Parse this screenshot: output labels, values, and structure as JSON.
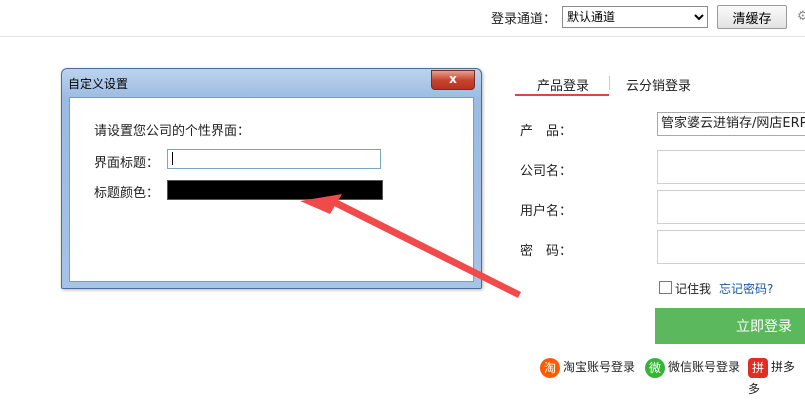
{
  "topbar": {
    "channel_label": "登录通道：",
    "channel_selected": "默认通道",
    "clear_cache": "清缓存"
  },
  "dialog": {
    "title": "自定义设置",
    "close_glyph": "x",
    "prompt": "请设置您公司的个性界面：",
    "title_label": "界面标题：",
    "title_value": "",
    "color_label": "标题颜色：",
    "color_value": "#000000"
  },
  "login": {
    "tabs": [
      {
        "label": "产品登录",
        "active": true
      },
      {
        "label": "云分销登录",
        "active": false
      }
    ],
    "product_label": "产　品：",
    "product_value": "管家婆云进销存/网店ERP",
    "company_label": "公司名：",
    "user_label": "用户名：",
    "password_label": "密　码：",
    "remember_label": "记住我",
    "forgot_label": "忘记密码?",
    "login_button": "立即登录",
    "third_party": [
      {
        "icon": "taobao-icon",
        "glyph": "淘",
        "label": "淘宝账号登录"
      },
      {
        "icon": "wechat-icon",
        "glyph": "微",
        "label": "微信账号登录"
      },
      {
        "icon": "pinduoduo-icon",
        "glyph": "拼",
        "label": "拼多多"
      }
    ]
  },
  "colors": {
    "accent_red": "#e0424a",
    "login_green": "#5cb85c",
    "arrow_red": "#f04a4a"
  }
}
